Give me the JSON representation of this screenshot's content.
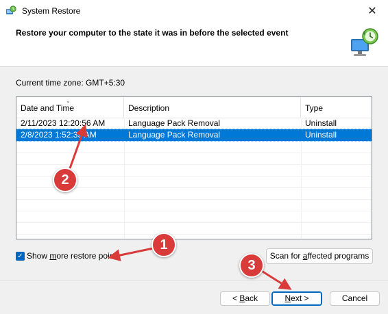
{
  "window": {
    "title": "System Restore",
    "close_glyph": "✕"
  },
  "header": {
    "title": "Restore your computer to the state it was in before the selected event"
  },
  "timezone": "Current time zone: GMT+5:30",
  "table": {
    "columns": [
      "Date and Time",
      "Description",
      "Type"
    ],
    "rows": [
      {
        "date": "2/11/2023 12:20:56 AM",
        "description": "Language Pack Removal",
        "type": "Uninstall",
        "selected": false
      },
      {
        "date": "2/8/2023 1:52:39 AM",
        "description": "Language Pack Removal",
        "type": "Uninstall",
        "selected": true
      }
    ]
  },
  "options": {
    "show_more_pre": "Show ",
    "show_more_access": "m",
    "show_more_post": "ore restore points",
    "show_more_checked": true,
    "scan_pre": "Scan for ",
    "scan_access": "a",
    "scan_post": "ffected programs"
  },
  "buttons": {
    "back_pre": "< ",
    "back_access": "B",
    "back_post": "ack",
    "next_access": "N",
    "next_post": "ext >",
    "cancel": "Cancel"
  },
  "annotations": {
    "one": "1",
    "two": "2",
    "three": "3",
    "color": "#d93a3a"
  },
  "colors": {
    "selection": "#0078d7",
    "accent": "#0067c0"
  }
}
